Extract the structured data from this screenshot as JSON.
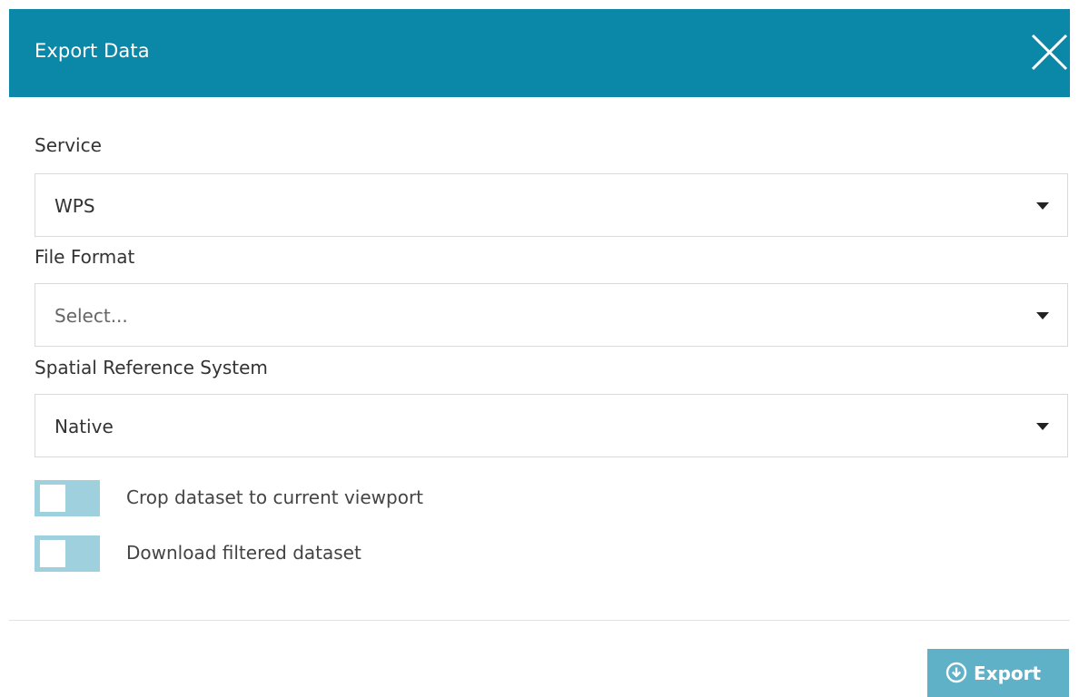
{
  "dialog": {
    "title": "Export Data",
    "close_icon": "close-icon"
  },
  "form": {
    "service": {
      "label": "Service",
      "value": "WPS"
    },
    "file_format": {
      "label": "File Format",
      "placeholder": "Select..."
    },
    "srs": {
      "label": "Spatial Reference System",
      "value": "Native"
    },
    "crop_toggle": {
      "label": "Crop dataset to current viewport",
      "checked": false
    },
    "filtered_toggle": {
      "label": "Download filtered dataset",
      "checked": false
    }
  },
  "footer": {
    "export_label": "Export",
    "export_icon": "download-circle-icon"
  },
  "colors": {
    "header": "#0b87a7",
    "toggle_off": "#9fd0dd",
    "button": "#5fb1c8"
  }
}
